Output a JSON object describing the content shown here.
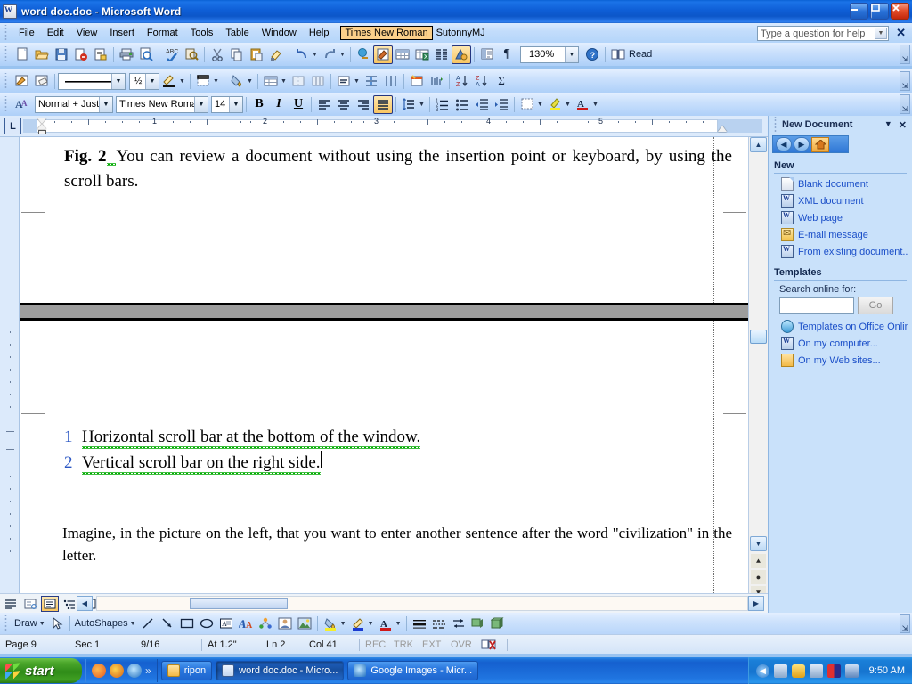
{
  "window": {
    "title": "word doc.doc - Microsoft Word",
    "icon": "word-document-icon",
    "minimize": "_",
    "maximize": "□",
    "close": "✕"
  },
  "menubar": {
    "items": [
      "File",
      "Edit",
      "View",
      "Insert",
      "Format",
      "Tools",
      "Table",
      "Window",
      "Help"
    ],
    "font_highlight": "Times New Roman",
    "font_secondary": "SutonnyMJ",
    "ask_placeholder": "Type a question for help",
    "close_label": "✕"
  },
  "standard_toolbar": {
    "buttons": [
      "new-document-icon",
      "open-icon",
      "save-icon",
      "permission-icon",
      "email-icon",
      "print-icon",
      "print-preview-icon",
      "spelling-grammar-icon",
      "research-icon",
      "cut-icon",
      "copy-icon",
      "paste-icon",
      "format-painter-icon",
      "undo-icon",
      "redo-icon",
      "insert-hyperlink-icon",
      "tables-and-borders-icon",
      "insert-table-icon",
      "insert-excel-sheet-icon",
      "columns-icon",
      "drawing-icon",
      "document-map-icon",
      "show-formatting-marks-icon"
    ],
    "zoom_value": "130%",
    "help_icon": "help-icon",
    "read_label": "Read",
    "read_icon": "read-book-icon"
  },
  "tables_borders_toolbar": {
    "buttons": [
      "draw-table-icon",
      "eraser-icon",
      "line-style-icon",
      "line-weight-icon",
      "border-color-icon",
      "borders-icon",
      "shading-color-icon",
      "insert-table-icon",
      "merge-cells-icon",
      "split-cells-icon",
      "align-icon",
      "distribute-rows-icon",
      "distribute-columns-icon",
      "table-autoformat-icon",
      "change-text-direction-icon",
      "sort-ascending-icon",
      "sort-descending-icon",
      "autosum-icon"
    ],
    "line_weight": "½"
  },
  "formatting_toolbar": {
    "styles_icon": "styles-and-formatting-icon",
    "style_value": "Normal + Justif",
    "font_value": "Times New Roman",
    "size_value": "14",
    "bold": "B",
    "italic": "I",
    "underline": "U",
    "align_left": "align-left-icon",
    "align_center": "align-center-icon",
    "align_right": "align-right-icon",
    "align_justify": "align-justify-icon",
    "line_spacing": "line-spacing-icon",
    "numbering": "numbering-icon",
    "bullets": "bullets-icon",
    "decrease_indent": "decrease-indent-icon",
    "increase_indent": "increase-indent-icon",
    "borders": "outside-border-icon",
    "highlight": "highlight-icon",
    "font_color": "font-color-icon",
    "active_button": "align-justify-icon"
  },
  "ruler": {
    "tab_stop": "L",
    "numbers": [
      "1",
      "2",
      "3",
      "4",
      "5"
    ],
    "unit": "inches"
  },
  "document": {
    "paragraph1": "Fig. 2 You can review a document without using the insertion point or keyboard, by using the scroll bars.",
    "p1_bold": "Fig. 2",
    "p1_rest": " You can review a document without using the insertion point or keyboard, by using the scroll bars.",
    "list": [
      {
        "number": "1",
        "text": "Horizontal scroll bar at the bottom of the window."
      },
      {
        "number": "2",
        "text": "Vertical scroll bar on the right side."
      }
    ],
    "paragraph3": "Imagine, in the picture on the left, that you want to enter another sentence after the word \"civilization\" in the letter."
  },
  "task_pane": {
    "title": "New Document",
    "dropdown_icon": "chevron-down-icon",
    "close_icon": "close-icon",
    "nav": {
      "back": "back-icon",
      "forward": "forward-icon",
      "home": "home-icon"
    },
    "new_section": "New",
    "new_items": [
      {
        "label": "Blank document",
        "icon": "blank-document-icon"
      },
      {
        "label": "XML document",
        "icon": "xml-document-icon"
      },
      {
        "label": "Web page",
        "icon": "web-page-icon"
      },
      {
        "label": "E-mail message",
        "icon": "email-message-icon"
      },
      {
        "label": "From existing document...",
        "icon": "existing-document-icon"
      }
    ],
    "templates_section": "Templates",
    "search_label": "Search online for:",
    "search_value": "",
    "go_label": "Go",
    "template_items": [
      {
        "label": "Templates on Office Onlin",
        "icon": "office-online-icon"
      },
      {
        "label": "On my computer...",
        "icon": "my-computer-templates-icon"
      },
      {
        "label": "On my Web sites...",
        "icon": "web-sites-templates-icon"
      }
    ]
  },
  "view_buttons": {
    "items": [
      "normal-view-icon",
      "web-layout-view-icon",
      "print-layout-view-icon",
      "outline-view-icon",
      "reading-layout-view-icon"
    ],
    "active": "print-layout-view-icon"
  },
  "drawing_toolbar": {
    "draw_label": "Draw",
    "select_icon": "select-objects-icon",
    "autoshapes_label": "AutoShapes",
    "items": [
      "line-icon",
      "arrow-icon",
      "rectangle-icon",
      "oval-icon",
      "text-box-icon",
      "wordart-icon",
      "diagram-icon",
      "clip-art-icon",
      "picture-icon",
      "fill-color-icon",
      "line-color-icon",
      "font-color-icon",
      "line-style-icon",
      "dash-style-icon",
      "arrow-style-icon",
      "shadow-style-icon",
      "3d-style-icon"
    ]
  },
  "status_bar": {
    "page": "Page 9",
    "section": "Sec 1",
    "page_of": "9/16",
    "at": "At 1.2\"",
    "line": "Ln 2",
    "column": "Col 41",
    "rec": "REC",
    "trk": "TRK",
    "ext": "EXT",
    "ovr": "OVR",
    "language_icon": "spelling-status-icon"
  },
  "taskbar": {
    "start_label": "start",
    "quick_launch": [
      "firefox-icon",
      "browser-icon",
      "internet-explorer-icon",
      "more-icon"
    ],
    "windows": [
      {
        "label": "ripon",
        "icon": "folder-icon",
        "active": false
      },
      {
        "label": "word doc.doc - Micro...",
        "icon": "word-icon",
        "active": true
      },
      {
        "label": "Google Images - Micr...",
        "icon": "ie-icon",
        "active": false
      }
    ],
    "tray_icons": [
      "show-hide-icon",
      "network-icon",
      "security-icon",
      "network2-icon",
      "audio-icon",
      "tablet-icon"
    ],
    "clock": "9:50 AM"
  },
  "colors": {
    "title_blue": "#0c56c8",
    "toolbar_blue": "#cde2fc",
    "taskpane_blue": "#c9e1fa",
    "link_blue": "#1b4fc8",
    "list_number_blue": "#2b57c4",
    "highlight_orange": "#fbd08a",
    "start_green": "#4ca72c"
  }
}
